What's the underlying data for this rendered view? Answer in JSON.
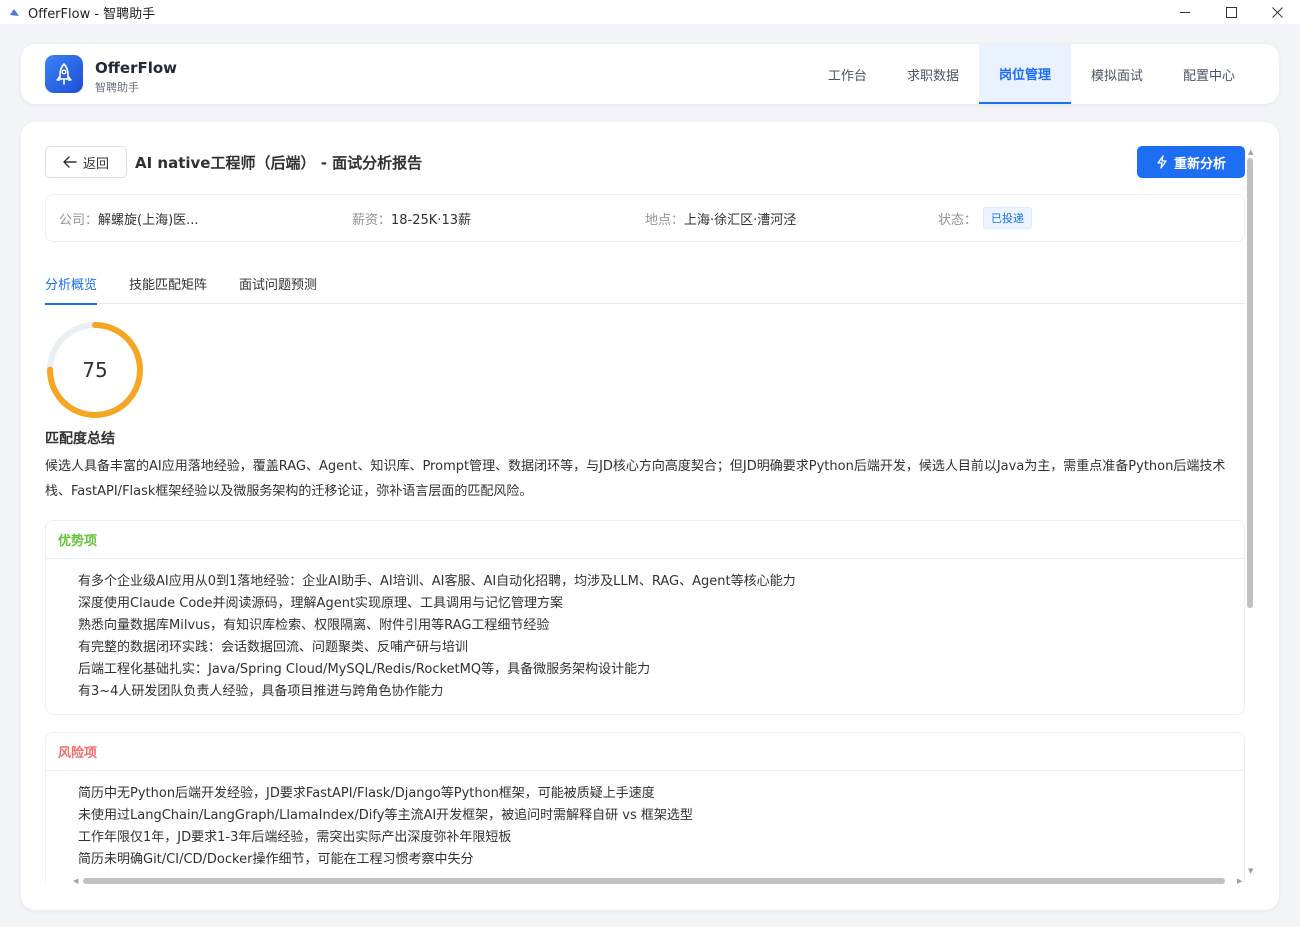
{
  "window": {
    "title": "OfferFlow - 智聘助手"
  },
  "header": {
    "brand_name": "OfferFlow",
    "brand_sub": "智聘助手",
    "nav": [
      {
        "label": "工作台"
      },
      {
        "label": "求职数据"
      },
      {
        "label": "岗位管理",
        "active": true
      },
      {
        "label": "模拟面试"
      },
      {
        "label": "配置中心"
      }
    ]
  },
  "page": {
    "back_label": "返回",
    "title": "AI native工程师（后端） - 面试分析报告",
    "reanalyze_label": "重新分析"
  },
  "info": {
    "company_label": "公司：",
    "company_value": "解螺旋(上海)医...",
    "salary_label": "薪资：",
    "salary_value": "18-25K·13薪",
    "location_label": "地点：",
    "location_value": "上海·徐汇区·漕河泾",
    "status_label": "状态：",
    "status_value": "已投递"
  },
  "tabs": [
    {
      "label": "分析概览",
      "active": true
    },
    {
      "label": "技能匹配矩阵"
    },
    {
      "label": "面试问题预测"
    }
  ],
  "score": {
    "value": 75,
    "max": 100,
    "color": "#f5a623"
  },
  "summary": {
    "title": "匹配度总结",
    "text": "候选人具备丰富的AI应用落地经验，覆盖RAG、Agent、知识库、Prompt管理、数据闭环等，与JD核心方向高度契合；但JD明确要求Python后端开发，候选人目前以Java为主，需重点准备Python后端技术栈、FastAPI/Flask框架经验以及微服务架构的迁移论证，弥补语言层面的匹配风险。"
  },
  "strengths": {
    "title": "优势项",
    "items": [
      "有多个企业级AI应用从0到1落地经验：企业AI助手、AI培训、AI客服、AI自动化招聘，均涉及LLM、RAG、Agent等核心能力",
      "深度使用Claude Code并阅读源码，理解Agent实现原理、工具调用与记忆管理方案",
      "熟悉向量数据库Milvus，有知识库检索、权限隔离、附件引用等RAG工程细节经验",
      "有完整的数据闭环实践：会话数据回流、问题聚类、反哺产研与培训",
      "后端工程化基础扎实：Java/Spring Cloud/MySQL/Redis/RocketMQ等，具备微服务架构设计能力",
      "有3~4人研发团队负责人经验，具备项目推进与跨角色协作能力"
    ]
  },
  "risks": {
    "title": "风险项",
    "items": [
      "简历中无Python后端开发经验，JD要求FastAPI/Flask/Django等Python框架，可能被质疑上手速度",
      "未使用过LangChain/LangGraph/LlamaIndex/Dify等主流AI开发框架，被追问时需解释自研 vs 框架选型",
      "工作年限仅1年，JD要求1-3年后端经验，需突出实际产出深度弥补年限短板",
      "简历未明确Git/CI/CD/Docker操作细节，可能在工程习惯考察中失分"
    ]
  }
}
